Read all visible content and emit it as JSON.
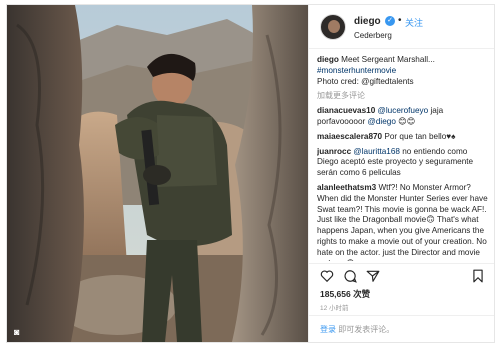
{
  "post": {
    "username": "diego",
    "follow_label": "关注",
    "location": "Cederberg",
    "separator": "•"
  },
  "comments": [
    {
      "user": "diego",
      "text": "Meet Sergeant Marshall...",
      "extra": [
        "#monsterhuntermovie",
        "Photo cred: @giftedtalents"
      ]
    },
    {
      "load_more": "加载更多评论"
    },
    {
      "user": "dianacuevas10",
      "mention": "@lucerofueyo",
      "text": " jaja porfavooooor ",
      "mention2": "@diego",
      "tail": " 😊😊"
    },
    {
      "user": "maiaescalera870",
      "text": "Por que tan bello♥♠"
    },
    {
      "user": "juanrocc",
      "mention": "@lauritta168",
      "text": " no entiendo como Diego aceptó este proyecto y seguramente serán como 6 peliculas"
    },
    {
      "user": "alanleethatsm3",
      "text": "Wtf?! No Monster Armor? When did the Monster Hunter Series ever have Swat team?! This movie is gonna be wack AF!. Just like the Dragonball movie🙃 That's what happens Japan, when you give Americans the rights to make a movie out of your creation. No hate on the actor. just the Director and movie makers.🙃"
    }
  ],
  "likes_text": "185,656 次赞",
  "time_text": "12 小时前",
  "footer": {
    "login_label": "登录",
    "rest_text": " 即可发表评论。"
  },
  "icons": {
    "heart": "heart-icon",
    "comment": "comment-icon",
    "share": "share-icon",
    "save": "bookmark-icon",
    "photo_corner": "instagram-glyph"
  },
  "colors": {
    "link": "#3897f0",
    "muted": "#999999",
    "verified": "#3897f0"
  }
}
